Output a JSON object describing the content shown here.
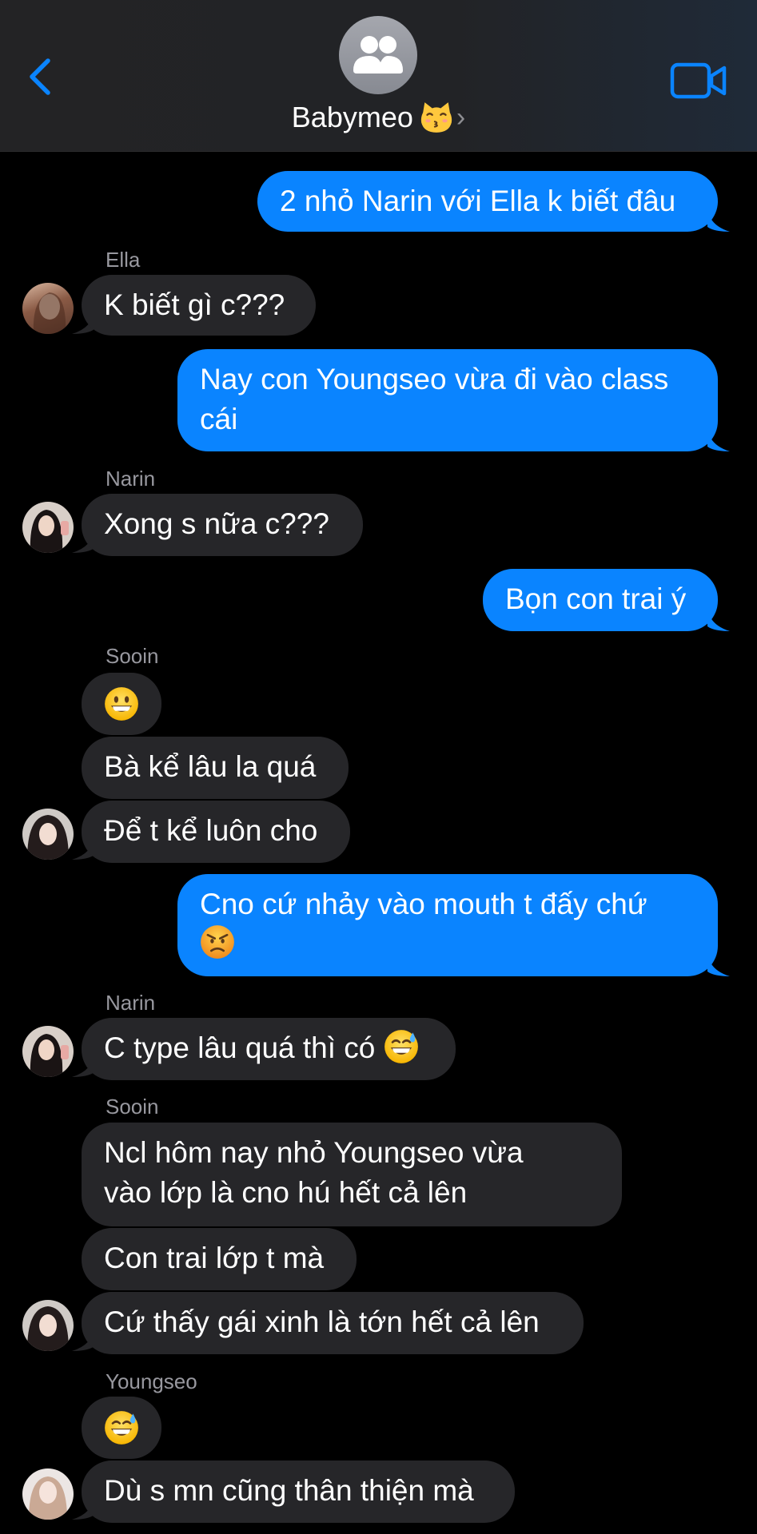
{
  "header": {
    "title": "Babymeo",
    "title_emoji": "kissing-cat-emoji",
    "chevron": "›",
    "back_icon": "chevron-left-icon",
    "video_icon": "video-camera-icon",
    "avatar_icon": "group-people-icon"
  },
  "colors": {
    "sent_bubble": "#0a84ff",
    "received_bubble": "#262629",
    "background": "#000000",
    "sender_name": "#98989f",
    "accent": "#0a84ff"
  },
  "messages": [
    {
      "from": "me",
      "text": "2 nhỏ Narin với Ella k biết đâu"
    },
    {
      "from": "Ella",
      "sender_label": "Ella",
      "text": "K biết gì c???"
    },
    {
      "from": "me",
      "line1": "Nay con Youngseo vừa đi vào class",
      "line2": "cái"
    },
    {
      "from": "Narin",
      "sender_label": "Narin",
      "text": "Xong s nữa c???"
    },
    {
      "from": "me",
      "text": "Bọn con trai ý"
    },
    {
      "from": "Sooin",
      "sender_label": "Sooin",
      "emoji": "grinning-face-emoji"
    },
    {
      "from": "Sooin",
      "text": "Bà kể lâu la quá"
    },
    {
      "from": "Sooin",
      "text": "Để t kể luôn cho"
    },
    {
      "from": "me",
      "line1": "Cno cứ nhảy vào mouth t đấy chứ",
      "emoji": "angry-face-emoji"
    },
    {
      "from": "Narin",
      "sender_label": "Narin",
      "text": "C type lâu quá thì có",
      "emoji": "grinning-sweat-emoji"
    },
    {
      "from": "Sooin",
      "sender_label": "Sooin",
      "line1": "Ncl hôm nay nhỏ Youngseo vừa",
      "line2": "vào lớp là cno hú hết cả lên"
    },
    {
      "from": "Sooin",
      "text": "Con trai lớp t mà"
    },
    {
      "from": "Sooin",
      "text": "Cứ thấy gái xinh là tớn hết cả lên"
    },
    {
      "from": "Youngseo",
      "sender_label": "Youngseo",
      "emoji": "grinning-sweat-emoji"
    },
    {
      "from": "Youngseo",
      "text": "Dù s mn cũng thân thiện mà"
    }
  ]
}
